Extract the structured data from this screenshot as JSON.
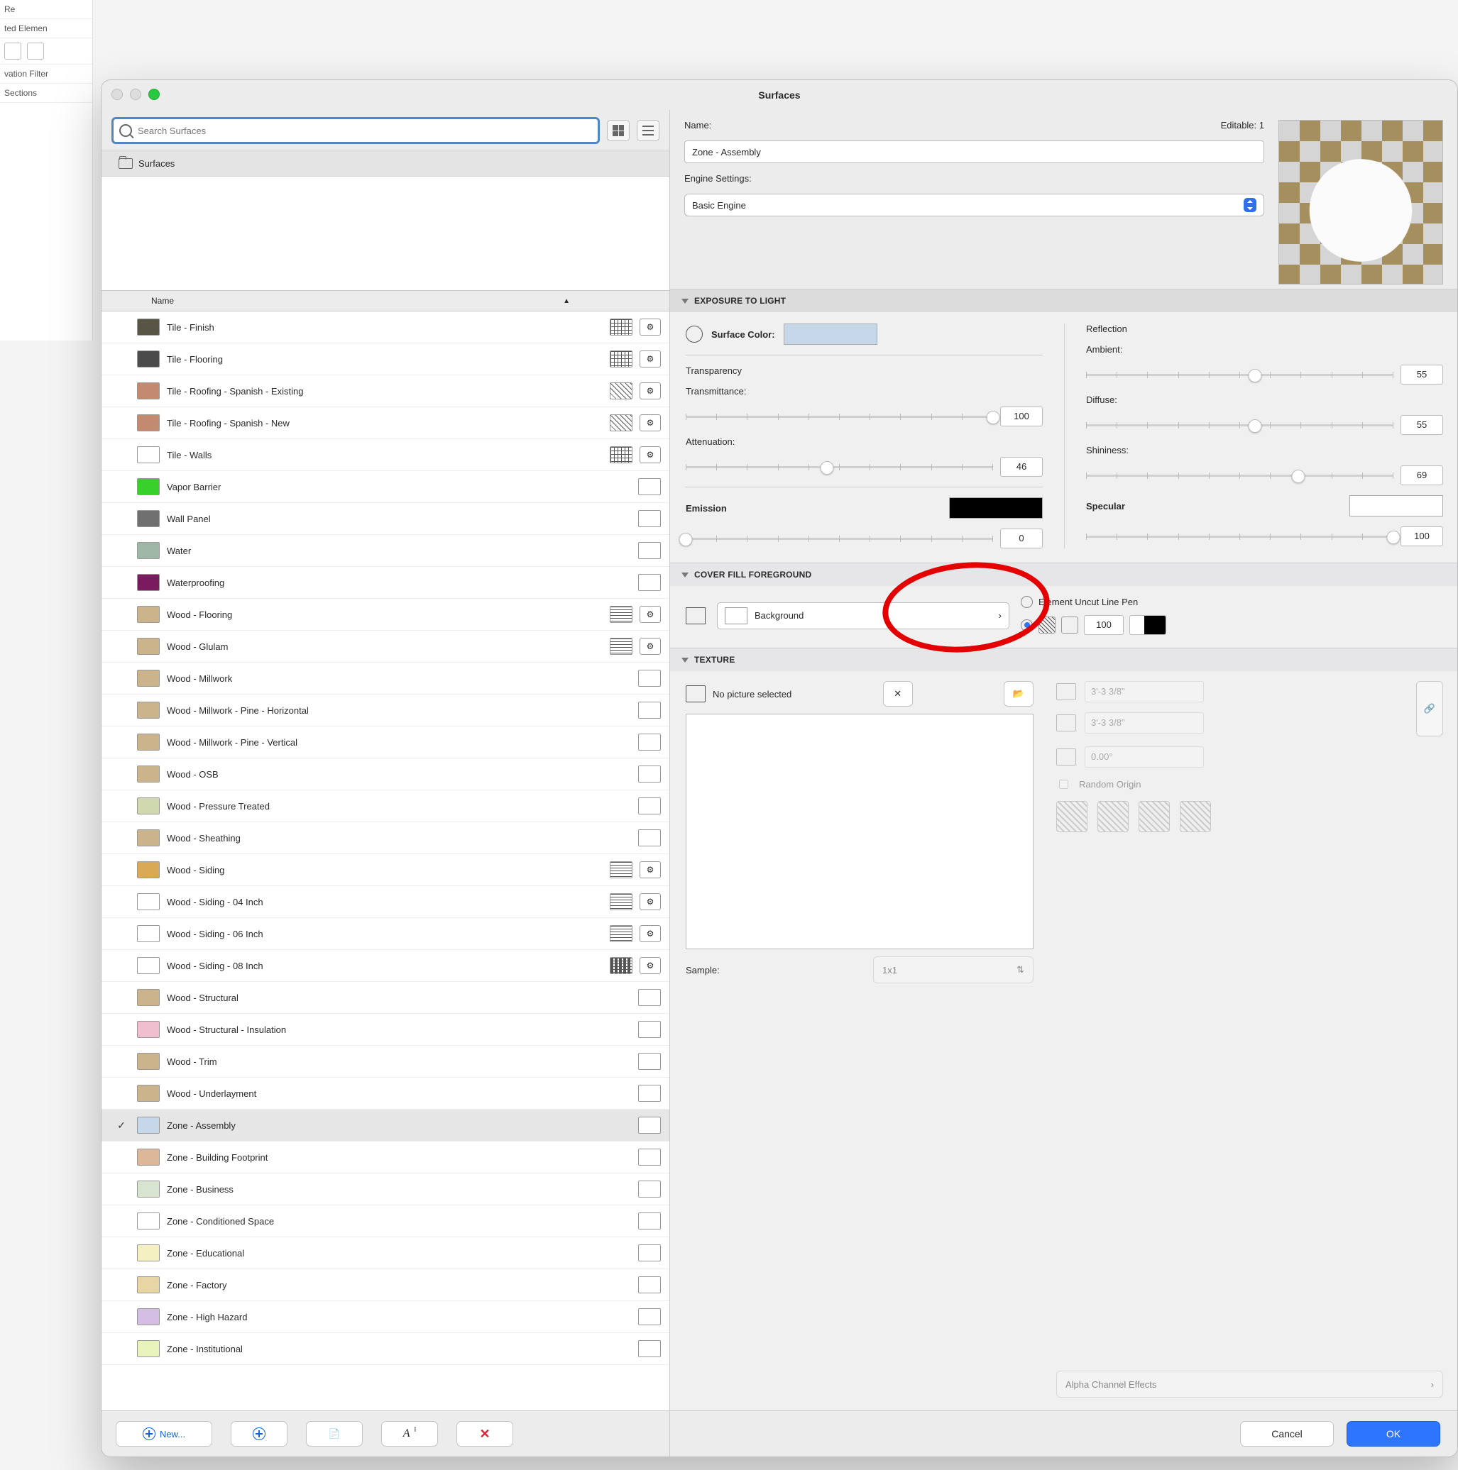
{
  "hints": {
    "left_items": [
      "Re",
      "ted Elemen",
      "",
      "vation Filter",
      "Sections"
    ]
  },
  "window": {
    "title": "Surfaces"
  },
  "search": {
    "placeholder": "Search Surfaces"
  },
  "folder": {
    "label": "Surfaces"
  },
  "list": {
    "header": "Name",
    "rows": [
      {
        "name": "Tile - Finish",
        "color": "#585544",
        "hatch": "grid",
        "sel": false,
        "hidden": true
      },
      {
        "name": "Tile - Flooring",
        "color": "#4b4b4b",
        "hatch": "grid",
        "sel": false
      },
      {
        "name": "Tile - Roofing - Spanish - Existing",
        "color": "#c48a6f",
        "hatch": "diag",
        "sel": false
      },
      {
        "name": "Tile - Roofing - Spanish - New",
        "color": "#c48a6f",
        "hatch": "diag",
        "sel": false
      },
      {
        "name": "Tile - Walls",
        "color": "#ffffff",
        "hatch": "grid",
        "sel": false
      },
      {
        "name": "Vapor Barrier",
        "color": "#37d12a",
        "hatch": "none",
        "sel": false,
        "noGear": true
      },
      {
        "name": "Wall Panel",
        "color": "#707070",
        "hatch": "none",
        "sel": false,
        "noGear": true
      },
      {
        "name": "Water",
        "color": "#9fb7a7",
        "hatch": "none",
        "sel": false,
        "noGear": true
      },
      {
        "name": "Waterproofing",
        "color": "#7a1a5f",
        "hatch": "none",
        "sel": false,
        "noGear": true
      },
      {
        "name": "Wood - Flooring",
        "color": "#cbb38b",
        "hatch": "lines",
        "sel": false
      },
      {
        "name": "Wood - Glulam",
        "color": "#cbb38b",
        "hatch": "lines",
        "sel": false
      },
      {
        "name": "Wood - Millwork",
        "color": "#cbb38b",
        "hatch": "none",
        "sel": false,
        "noGear": true
      },
      {
        "name": "Wood - Millwork - Pine - Horizontal",
        "color": "#cbb38b",
        "hatch": "none",
        "sel": false,
        "noGear": true
      },
      {
        "name": "Wood - Millwork - Pine - Vertical",
        "color": "#cbb38b",
        "hatch": "none",
        "sel": false,
        "noGear": true
      },
      {
        "name": "Wood - OSB",
        "color": "#cbb38b",
        "hatch": "none",
        "sel": false,
        "noGear": true
      },
      {
        "name": "Wood - Pressure Treated",
        "color": "#cfd8ae",
        "hatch": "none",
        "sel": false,
        "noGear": true
      },
      {
        "name": "Wood - Sheathing",
        "color": "#cbb38b",
        "hatch": "none",
        "sel": false,
        "noGear": true
      },
      {
        "name": "Wood - Siding",
        "color": "#d9a955",
        "hatch": "lines",
        "sel": false
      },
      {
        "name": "Wood - Siding - 04 Inch",
        "color": "#ffffff",
        "hatch": "lines",
        "sel": false
      },
      {
        "name": "Wood - Siding - 06 Inch",
        "color": "#ffffff",
        "hatch": "lines",
        "sel": false
      },
      {
        "name": "Wood - Siding - 08 Inch",
        "color": "#ffffff",
        "hatch": "dash",
        "sel": false
      },
      {
        "name": "Wood - Structural",
        "color": "#cbb38b",
        "hatch": "none",
        "sel": false,
        "noGear": true
      },
      {
        "name": "Wood - Structural - Insulation",
        "color": "#efbfd0",
        "hatch": "none",
        "sel": false,
        "noGear": true
      },
      {
        "name": "Wood - Trim",
        "color": "#cbb38b",
        "hatch": "none",
        "sel": false,
        "noGear": true
      },
      {
        "name": "Wood - Underlayment",
        "color": "#cbb38b",
        "hatch": "none",
        "sel": false,
        "noGear": true
      },
      {
        "name": "Zone - Assembly",
        "color": "#c7d7ea",
        "hatch": "none",
        "sel": true,
        "noGear": true
      },
      {
        "name": "Zone - Building Footprint",
        "color": "#ddb79a",
        "hatch": "none",
        "sel": false,
        "noGear": true
      },
      {
        "name": "Zone - Business",
        "color": "#d7e4cf",
        "hatch": "none",
        "sel": false,
        "noGear": true
      },
      {
        "name": "Zone - Conditioned Space",
        "color": "#ffffff",
        "hatch": "none",
        "sel": false,
        "noGear": true
      },
      {
        "name": "Zone - Educational",
        "color": "#f4f0c2",
        "hatch": "none",
        "sel": false,
        "noGear": true
      },
      {
        "name": "Zone - Factory",
        "color": "#e8d5a4",
        "hatch": "none",
        "sel": false,
        "noGear": true
      },
      {
        "name": "Zone - High Hazard",
        "color": "#d4bee3",
        "hatch": "none",
        "sel": false,
        "noGear": true
      },
      {
        "name": "Zone - Institutional",
        "color": "#e9f4bc",
        "hatch": "none",
        "sel": false,
        "noGear": true
      }
    ]
  },
  "left_buttons": {
    "new": "New..."
  },
  "name_panel": {
    "label": "Name:",
    "editable": "Editable: 1",
    "value": "Zone - Assembly",
    "engine_label": "Engine Settings:",
    "engine_value": "Basic Engine"
  },
  "exposure": {
    "title": "EXPOSURE TO LIGHT",
    "surface_color_label": "Surface Color:",
    "surface_color": "#c7d7ea",
    "transparency_label": "Transparency",
    "transmittance_label": "Transmittance:",
    "transmittance": 100,
    "attenuation_label": "Attenuation:",
    "attenuation": 46,
    "emission_label": "Emission",
    "emission_color": "#000000",
    "emission_value": 0,
    "reflection_label": "Reflection",
    "ambient_label": "Ambient:",
    "ambient": 55,
    "diffuse_label": "Diffuse:",
    "diffuse": 55,
    "shininess_label": "Shininess:",
    "shininess": 69,
    "specular_label": "Specular",
    "specular_color": "#ffffff",
    "specular_value": 100
  },
  "cover": {
    "title": "COVER FILL FOREGROUND",
    "fill_label": "Background",
    "uncut_label": "Element Uncut Line Pen",
    "pen_value": "100"
  },
  "texture": {
    "title": "TEXTURE",
    "none_label": "No picture selected",
    "dim_x": "3'-3 3/8\"",
    "dim_y": "3'-3 3/8\"",
    "angle": "0.00°",
    "random_origin_label": "Random Origin",
    "sample_label": "Sample:",
    "sample_value": "1x1",
    "alpha_label": "Alpha Channel Effects"
  },
  "footer": {
    "cancel": "Cancel",
    "ok": "OK"
  }
}
